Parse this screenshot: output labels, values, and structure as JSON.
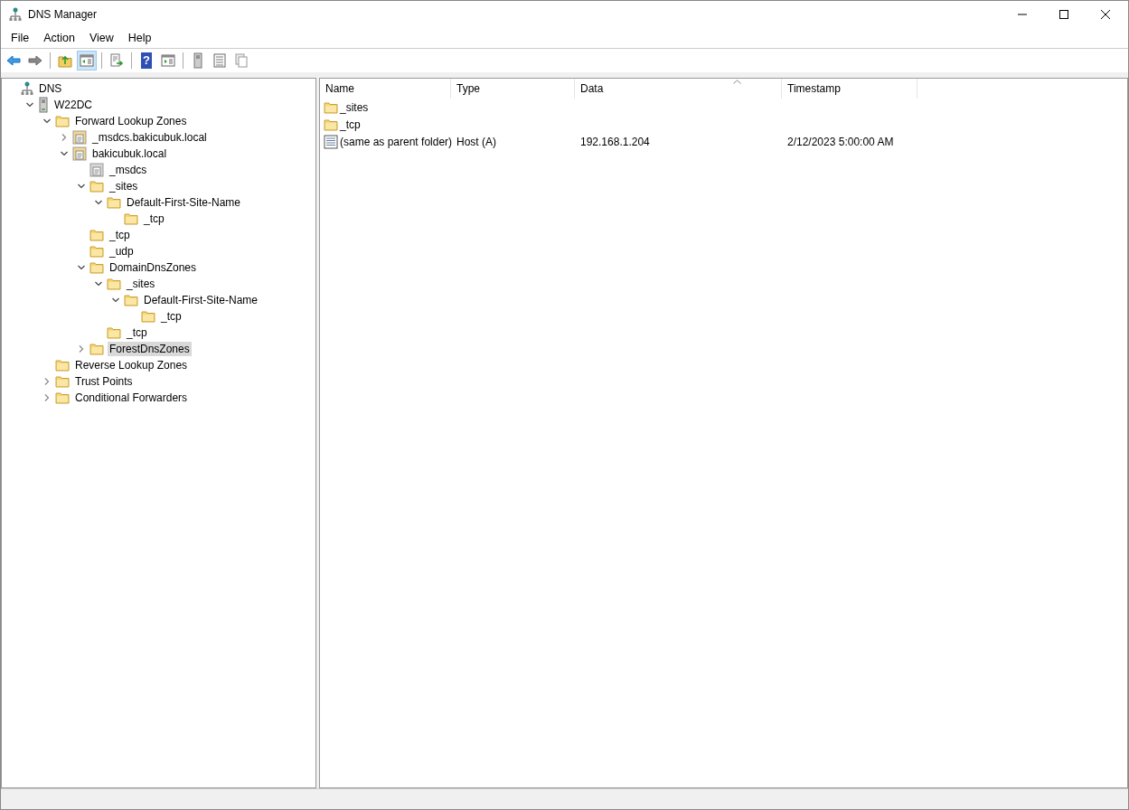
{
  "window": {
    "title": "DNS Manager"
  },
  "menu": [
    "File",
    "Action",
    "View",
    "Help"
  ],
  "toolbar": [
    [
      {
        "kind": "back",
        "selected": false
      },
      {
        "kind": "forward",
        "selected": false
      }
    ],
    [
      {
        "kind": "up",
        "selected": false
      },
      {
        "kind": "tree",
        "selected": true
      }
    ],
    [
      {
        "kind": "export",
        "selected": false
      }
    ],
    [
      {
        "kind": "help",
        "label": "?",
        "selected": false
      },
      {
        "kind": "pane",
        "selected": false
      }
    ],
    [
      {
        "kind": "server",
        "selected": false
      },
      {
        "kind": "list",
        "selected": false
      },
      {
        "kind": "copy",
        "selected": false
      }
    ]
  ],
  "tree": [
    {
      "label": "DNS",
      "kind": "network",
      "selected": false,
      "children": [
        {
          "label": "W22DC",
          "kind": "server",
          "expanded": true,
          "selected": false,
          "children": [
            {
              "label": "Forward Lookup Zones",
              "kind": "folder",
              "expanded": true,
              "selected": false,
              "children": [
                {
                  "label": "_msdcs.bakicubuk.local",
                  "kind": "zone",
                  "expanded": false,
                  "selected": false
                },
                {
                  "label": "bakicubuk.local",
                  "kind": "zone",
                  "expanded": true,
                  "selected": false,
                  "children": [
                    {
                      "label": "_msdcs",
                      "kind": "delegation",
                      "selected": false
                    },
                    {
                      "label": "_sites",
                      "kind": "folder",
                      "expanded": true,
                      "selected": false,
                      "children": [
                        {
                          "label": "Default-First-Site-Name",
                          "kind": "folder",
                          "expanded": true,
                          "selected": false,
                          "children": [
                            {
                              "label": "_tcp",
                              "kind": "folder",
                              "selected": false
                            }
                          ]
                        }
                      ]
                    },
                    {
                      "label": "_tcp",
                      "kind": "folder",
                      "selected": false
                    },
                    {
                      "label": "_udp",
                      "kind": "folder",
                      "selected": false
                    },
                    {
                      "label": "DomainDnsZones",
                      "kind": "folder",
                      "expanded": true,
                      "selected": false,
                      "children": [
                        {
                          "label": "_sites",
                          "kind": "folder",
                          "expanded": true,
                          "selected": false,
                          "children": [
                            {
                              "label": "Default-First-Site-Name",
                              "kind": "folder",
                              "expanded": true,
                              "selected": false,
                              "children": [
                                {
                                  "label": "_tcp",
                                  "kind": "folder",
                                  "selected": false
                                }
                              ]
                            }
                          ]
                        },
                        {
                          "label": "_tcp",
                          "kind": "folder",
                          "selected": false
                        }
                      ]
                    },
                    {
                      "label": "ForestDnsZones",
                      "kind": "folder",
                      "expanded": false,
                      "selected": true
                    }
                  ]
                }
              ]
            },
            {
              "label": "Reverse Lookup Zones",
              "kind": "folder",
              "selected": false
            },
            {
              "label": "Trust Points",
              "kind": "folder",
              "expanded": false,
              "selected": false
            },
            {
              "label": "Conditional Forwarders",
              "kind": "folder",
              "expanded": false,
              "selected": false
            }
          ]
        }
      ]
    }
  ],
  "table": {
    "columns": [
      {
        "label": "Name",
        "sorted": false
      },
      {
        "label": "Type",
        "sorted": false
      },
      {
        "label": "Data",
        "sorted": true
      },
      {
        "label": "Timestamp",
        "sorted": false
      }
    ],
    "rows": [
      {
        "kind": "folder",
        "name": "_sites"
      },
      {
        "kind": "folder",
        "name": "_tcp"
      },
      {
        "kind": "record",
        "name": "(same as parent folder)",
        "type": "Host (A)",
        "data": "192.168.1.204",
        "timestamp": "2/12/2023 5:00:00 AM"
      }
    ]
  }
}
